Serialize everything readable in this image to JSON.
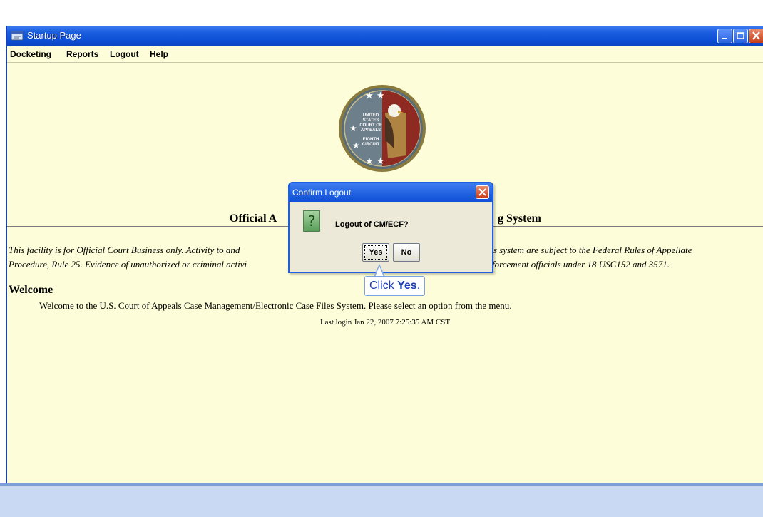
{
  "window": {
    "title": "Startup Page"
  },
  "menu": {
    "items": [
      "Docketing",
      "Reports",
      "Logout",
      "Help"
    ]
  },
  "seal": {
    "text_lines": [
      "UNITED",
      "STATES",
      "COURT OF",
      "APPEALS",
      "EIGHTH",
      "CIRCUIT"
    ]
  },
  "main": {
    "heading_left": "Official A",
    "heading_right": "g System",
    "notice_line1_left": "This facility is for Official Court Business only. Activity to and",
    "notice_line1_right": "s system are subject to the Federal Rules of Appellate",
    "notice_line2_left": "Procedure, Rule 25. Evidence of unauthorized or criminal activi",
    "notice_line2_right": "forcement officials under 18 USC152 and 3571.",
    "welcome_heading": "Welcome",
    "welcome_text": "Welcome to the U.S. Court of Appeals Case Management/Electronic Case Files System. Please select an option from the menu.",
    "last_login": "Last login Jan 22, 2007 7:25:35 AM CST"
  },
  "dialog": {
    "title": "Confirm Logout",
    "message": "Logout of CM/ECF?",
    "yes_label": "Yes",
    "no_label": "No"
  },
  "callout": {
    "prefix": "Click ",
    "emphasis": "Yes",
    "suffix": "."
  },
  "colors": {
    "titlebar": "#0d4fd6",
    "page_background": "#fdfdd9",
    "callout_text": "#1a3fb8"
  }
}
